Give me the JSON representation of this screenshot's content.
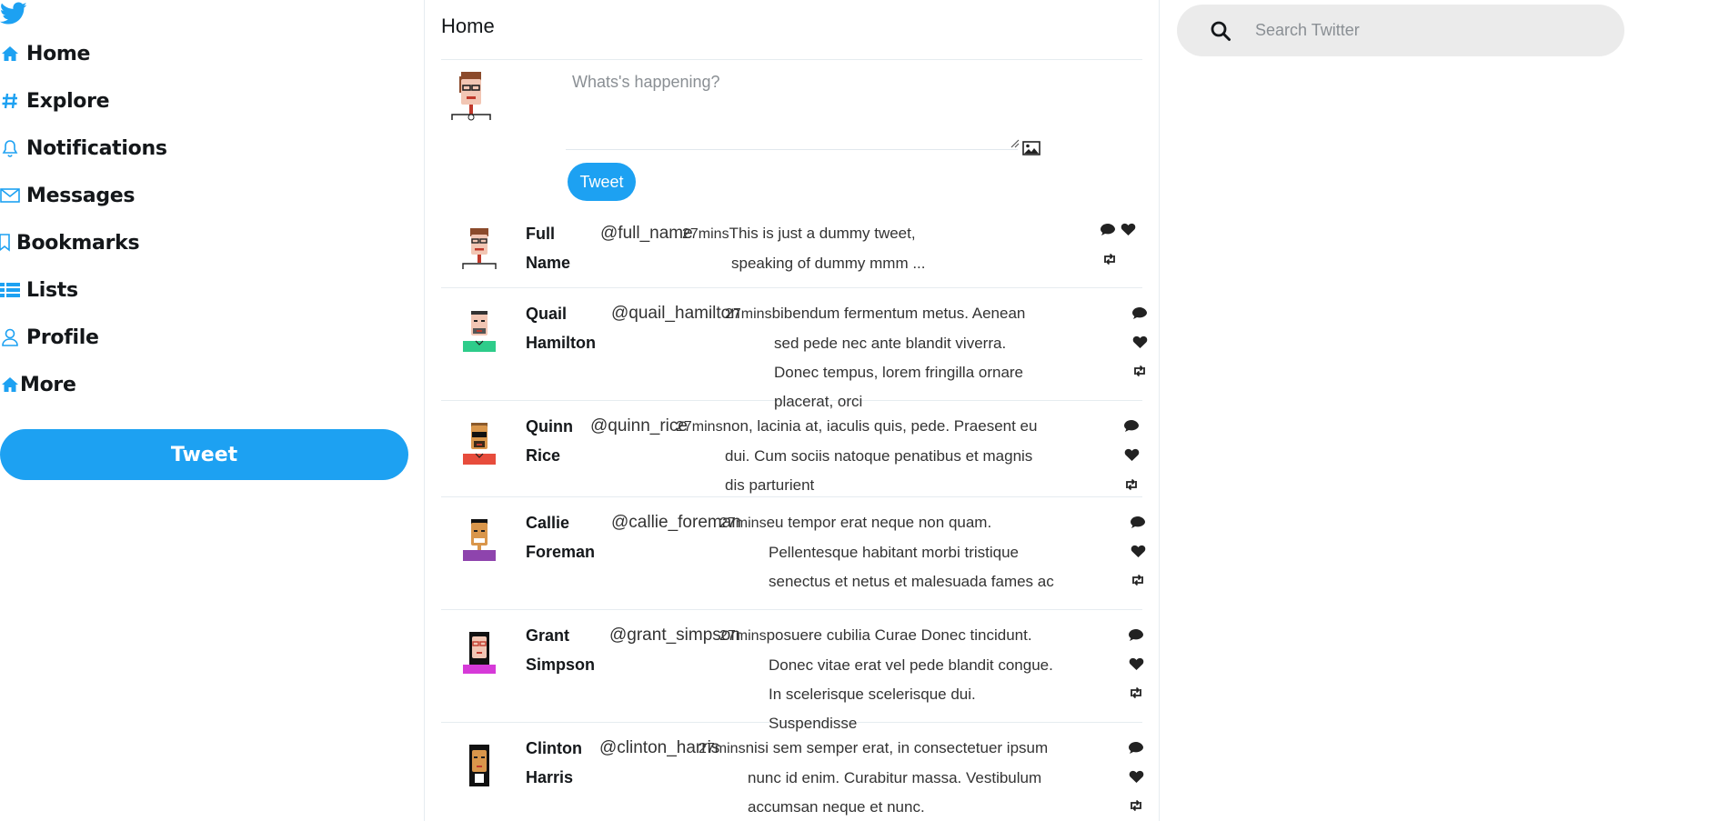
{
  "sidebar": {
    "logo": "twitter-bird-icon",
    "items": [
      {
        "label": "Home",
        "icon": "home-icon"
      },
      {
        "label": "Explore",
        "icon": "hashtag-icon"
      },
      {
        "label": "Notifications",
        "icon": "bell-icon"
      },
      {
        "label": "Messages",
        "icon": "envelope-icon"
      },
      {
        "label": "Bookmarks",
        "icon": "bookmark-icon"
      },
      {
        "label": "Lists",
        "icon": "list-icon"
      },
      {
        "label": "Profile",
        "icon": "user-icon"
      },
      {
        "label": "More",
        "icon": "home-icon"
      }
    ],
    "tweet_button": "Tweet"
  },
  "main": {
    "title": "Home",
    "compose": {
      "placeholder": "Whats's happening?",
      "tweet_button": "Tweet"
    }
  },
  "feed": [
    {
      "name": "Full Name",
      "handle": "@full_name",
      "time": "27mins",
      "text": "This is just a dummy tweet, speaking of dummy mmm ..."
    },
    {
      "name": "Quail Hamilton",
      "handle": "@quail_hamilton",
      "time": "27mins",
      "text": "bibendum fermentum metus. Aenean sed pede nec ante blandit viverra. Donec tempus, lorem fringilla ornare placerat, orci"
    },
    {
      "name": "Quinn Rice",
      "handle": "@quinn_rice",
      "time": "27mins",
      "text": "non, lacinia at, iaculis quis, pede. Praesent eu dui. Cum sociis natoque penatibus et magnis dis parturient"
    },
    {
      "name": "Callie Foreman",
      "handle": "@callie_foreman",
      "time": "27mins",
      "text": "eu tempor erat neque non quam. Pellentesque habitant morbi tristique senectus et netus et malesuada fames ac"
    },
    {
      "name": "Grant Simpson",
      "handle": "@grant_simpson",
      "time": "27mins",
      "text": "posuere cubilia Curae Donec tincidunt. Donec vitae erat vel pede blandit congue. In scelerisque scelerisque dui. Suspendisse"
    },
    {
      "name": "Clinton Harris",
      "handle": "@clinton_harris",
      "time": "27mins",
      "text": "nisi sem semper erat, in consectetuer ipsum nunc id enim. Curabitur massa. Vestibulum accumsan neque et nunc."
    }
  ],
  "search": {
    "placeholder": "Search Twitter"
  },
  "colors": {
    "accent": "#1da1f2",
    "divider": "#e6ecf0",
    "search_bg": "#ebebeb"
  }
}
